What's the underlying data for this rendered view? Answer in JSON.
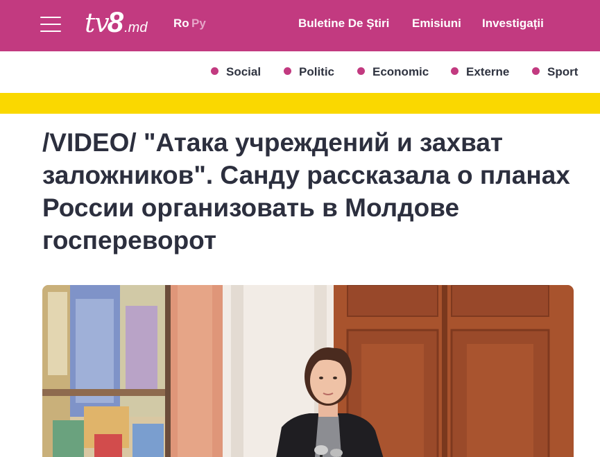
{
  "header": {
    "logo": {
      "tv": "tv",
      "eight": "8",
      "domain": ".md"
    },
    "languages": {
      "ro": "Ro",
      "ru": "Ру"
    },
    "nav": [
      "Buletine De Știri",
      "Emisiuni",
      "Investigații"
    ]
  },
  "categories": [
    "Social",
    "Politic",
    "Economic",
    "Externe",
    "Sport"
  ],
  "article": {
    "title": "/VIDEO/ \"Атака учреждений и захват заложников\". Санду рассказала о планах России организовать в Молдове госпереворот"
  },
  "colors": {
    "brand": "#c23a80",
    "accent_bar": "#fad800",
    "title_text": "#2c2f3e"
  }
}
